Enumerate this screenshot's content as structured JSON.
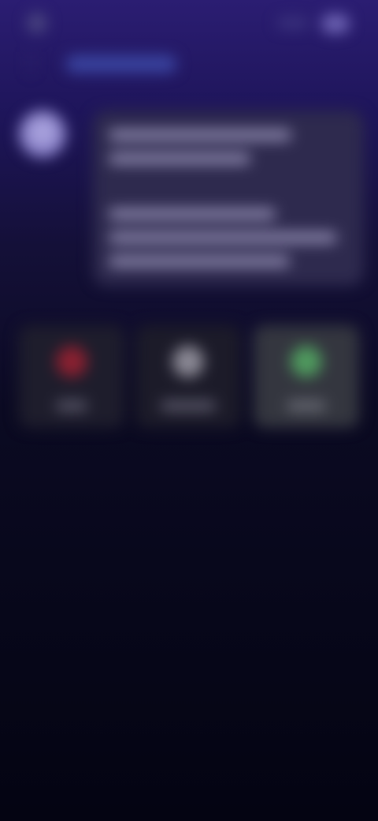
{
  "header": {
    "left_icon": "app-logo-icon",
    "title": "",
    "subtitle_link": "",
    "right_pill": "status-pill",
    "right_button_icon": "menu-icon"
  },
  "message": {
    "avatar": "assistant-avatar",
    "text": ""
  },
  "actions": [
    {
      "label": "",
      "icon": "record-icon",
      "color": "#8a2030"
    },
    {
      "label": "",
      "icon": "circle-icon",
      "color": "#8a8894"
    },
    {
      "label": "",
      "icon": "check-icon",
      "color": "#4f9a5e"
    }
  ],
  "colors": {
    "background_top": "#2b1d72",
    "background_bottom": "#040412",
    "accent": "#4b5ac8"
  }
}
